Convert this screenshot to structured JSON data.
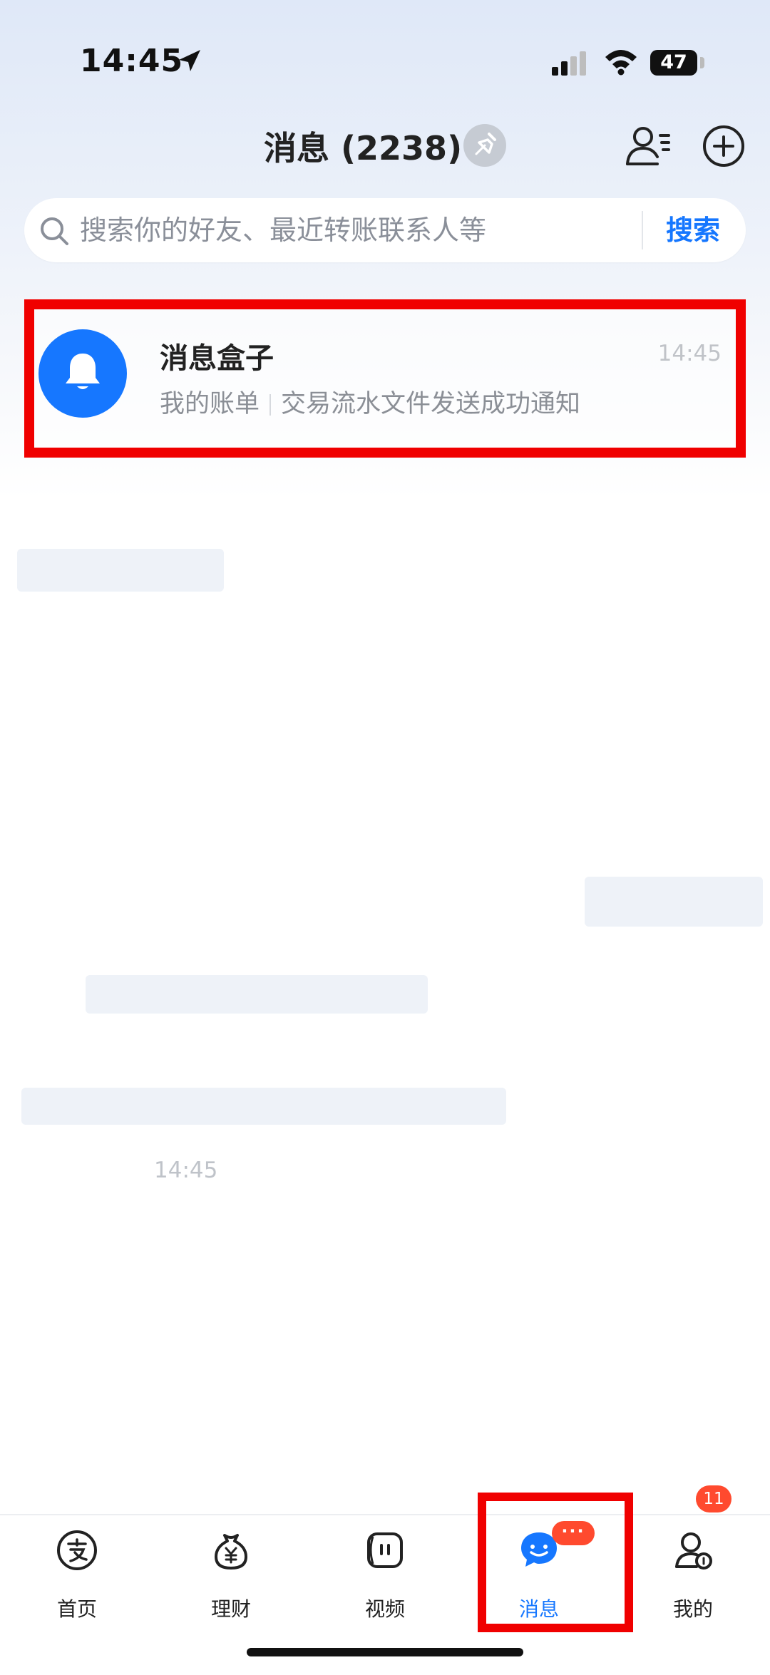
{
  "status_bar": {
    "time": "14:45",
    "battery": "47"
  },
  "header": {
    "title": "消息 (2238)"
  },
  "search": {
    "placeholder": "搜索你的好友、最近转账联系人等",
    "button_label": "搜索"
  },
  "messages": [
    {
      "title": "消息盒子",
      "time": "14:45",
      "preview_tag": "我的账单",
      "preview_text": "交易流水文件发送成功通知",
      "icon": "bell-icon",
      "avatar_color": "#1677ff"
    }
  ],
  "floating_time": "14:45",
  "tabs": [
    {
      "label": "首页",
      "icon": "alipay-icon"
    },
    {
      "label": "理财",
      "icon": "wealth-icon"
    },
    {
      "label": "视频",
      "icon": "video-icon"
    },
    {
      "label": "消息",
      "icon": "chat-icon",
      "active": true,
      "badge": "···"
    },
    {
      "label": "我的",
      "icon": "profile-icon",
      "badge": "11"
    }
  ],
  "colors": {
    "accent": "#1677ff",
    "badge": "#ff4a2e",
    "highlight_frame": "#f00000"
  }
}
